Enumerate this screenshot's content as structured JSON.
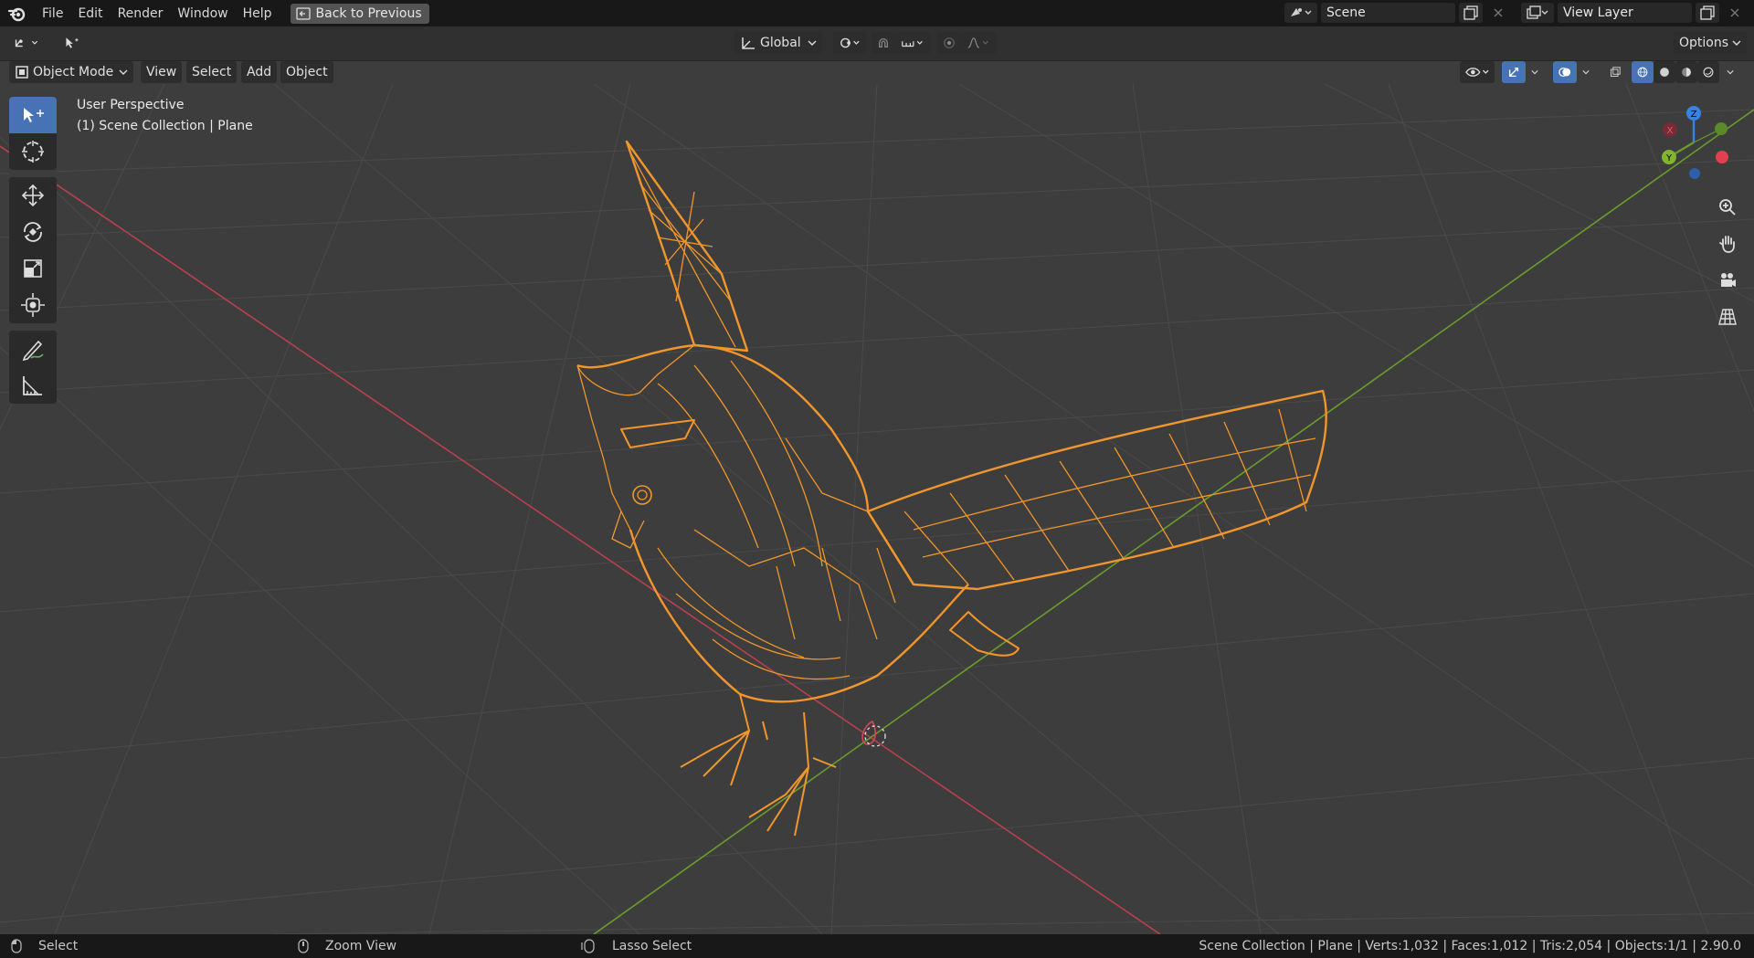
{
  "app": {
    "name": "Blender"
  },
  "menu": {
    "items": [
      "File",
      "Edit",
      "Render",
      "Window",
      "Help"
    ],
    "back_label": "Back to Previous"
  },
  "scene": {
    "value": "Scene"
  },
  "view_layer": {
    "value": "View Layer"
  },
  "header": {
    "orientation": "Global",
    "options_label": "Options"
  },
  "viewport_header": {
    "mode": "Object Mode",
    "menus": [
      "View",
      "Select",
      "Add",
      "Object"
    ]
  },
  "overlay": {
    "perspective": "User Perspective",
    "collection": "(1) Scene Collection | Plane"
  },
  "gizmo": {
    "x": "X",
    "y": "Y",
    "z": "Z"
  },
  "statusbar": {
    "select": "Select",
    "zoom": "Zoom View",
    "lasso": "Lasso Select",
    "info": "Scene Collection | Plane | Verts:1,032 | Faces:1,012 | Tris:2,054 | Objects:1/1 | 2.90.0"
  },
  "colors": {
    "selection": "#f0962c",
    "x_axis": "#b8404e",
    "y_axis": "#6a9c2c",
    "z_axis": "#3a82e0",
    "active_tool": "#4772b3"
  }
}
